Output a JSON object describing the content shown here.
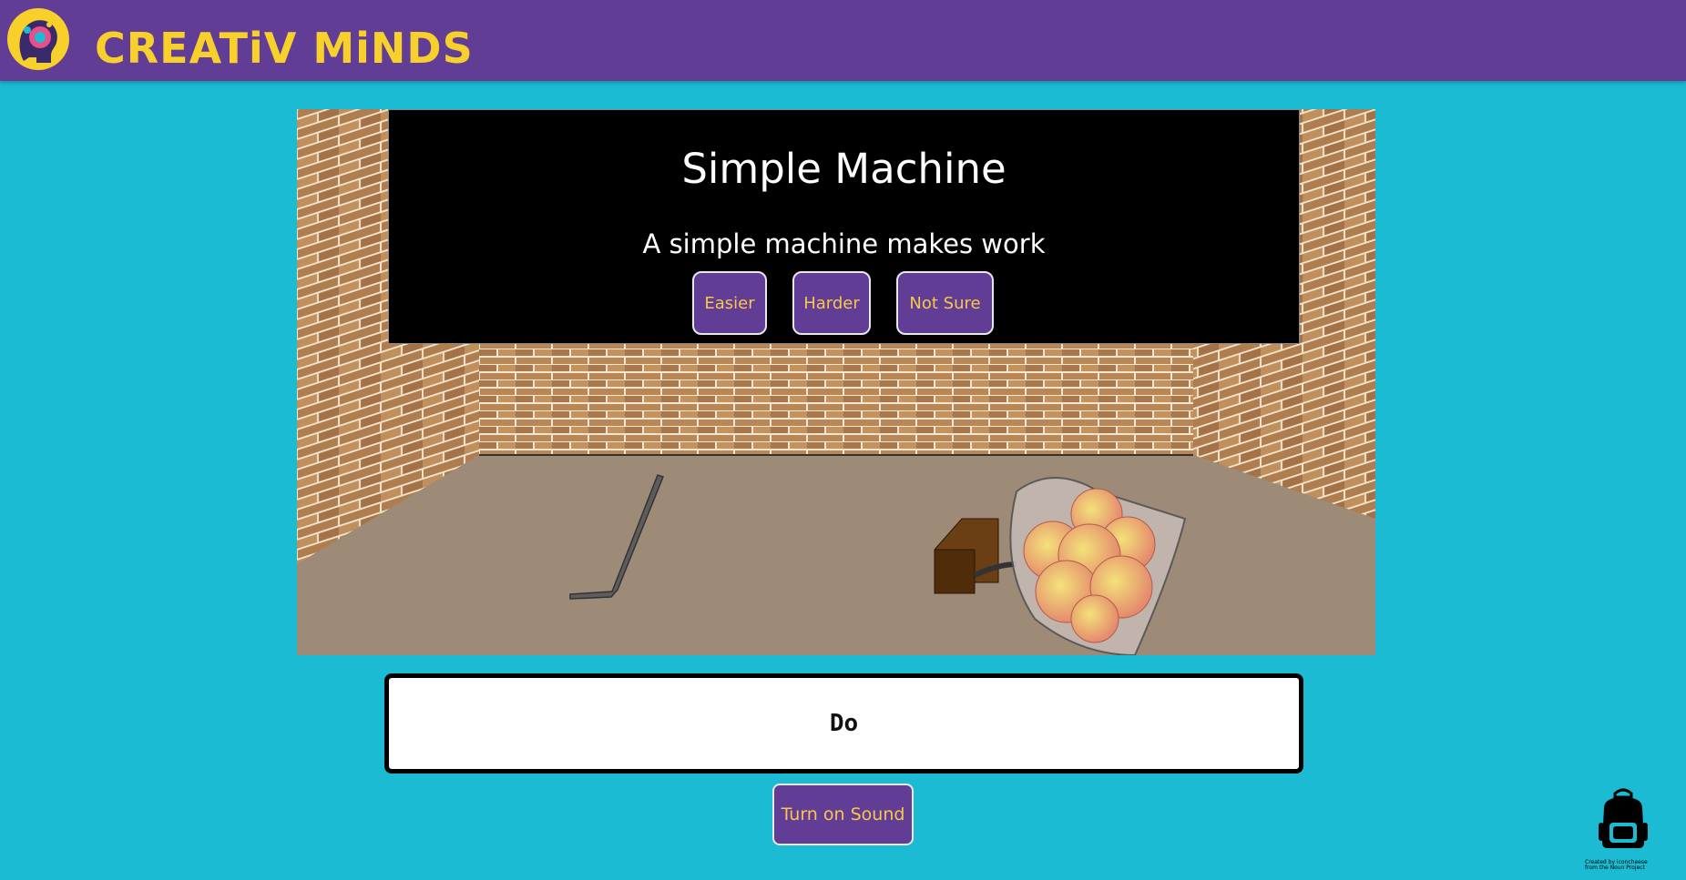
{
  "header": {
    "brand_name": "CREATiV MiNDS"
  },
  "question": {
    "title": "Simple Machine",
    "prompt": "A simple machine makes work",
    "choices": [
      {
        "label": "Easier"
      },
      {
        "label": "Harder"
      },
      {
        "label": "Not Sure"
      }
    ]
  },
  "scene": {
    "objects": [
      "brick-room",
      "crowbar",
      "wood-block",
      "bag-of-apples"
    ]
  },
  "answer": {
    "text": "Do"
  },
  "controls": {
    "sound_label": "Turn on Sound"
  },
  "footer": {
    "credit_line1": "Created by iconcheese",
    "credit_line2": "from the Noun Project"
  },
  "colors": {
    "header_bg": "#613d96",
    "page_bg": "#1bbbd3",
    "accent_yellow": "#f7d02c",
    "button_bg": "#613d96",
    "button_text": "#f7c84a"
  }
}
